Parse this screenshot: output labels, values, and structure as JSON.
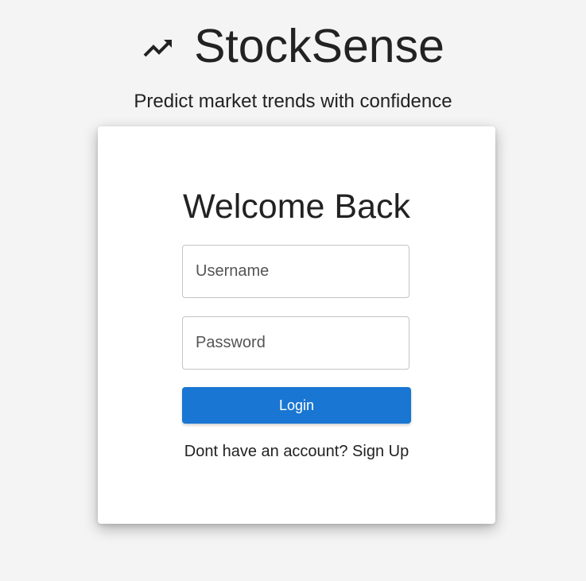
{
  "brand": {
    "title": "StockSense",
    "icon": "trending-up-icon",
    "tagline": "Predict market trends with confidence"
  },
  "login_card": {
    "title": "Welcome Back",
    "username_placeholder": "Username",
    "username_value": "",
    "password_placeholder": "Password",
    "password_value": "",
    "login_label": "Login",
    "signup_prompt": "Dont have an account?",
    "signup_link": "Sign Up"
  },
  "colors": {
    "background": "#f4f4f4",
    "primary": "#1976d2",
    "card": "#ffffff",
    "text": "#222222"
  }
}
